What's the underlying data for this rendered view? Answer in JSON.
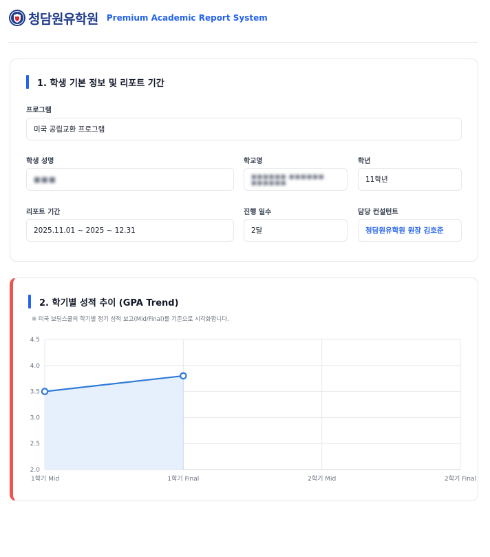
{
  "header": {
    "logo_text": "청담원유학원",
    "tagline": "Premium Academic Report System"
  },
  "section1": {
    "title": "1. 학생 기본 정보 및 리포트 기간",
    "program_label": "프로그램",
    "program_value": "미국 공립교환 프로그램",
    "student_name_label": "학생 성명",
    "student_name_value": "■■■",
    "school_label": "학교명",
    "school_value": "■■■■■■ ■■■■■■ ■■■■■■",
    "grade_label": "학년",
    "grade_value": "11학년",
    "period_label": "리포트 기간",
    "period_value": "2025.11.01 ~ 2025 ~ 12.31",
    "days_label": "진행 일수",
    "days_value": "2달",
    "consultant_label": "담당 컨설턴트",
    "consultant_value": "청담원유학원 원장 김호준"
  },
  "section2": {
    "title": "2. 학기별 성적 추이 (GPA Trend)",
    "note": "※ 미국 보딩스쿨의 학기별 정기 성적 보고(Mid/Final)를 기준으로 시각화합니다."
  },
  "colors": {
    "accent": "#2563eb",
    "card2_border": "#f05252",
    "line": "#2f7ad8",
    "fill": "#e6f0fd"
  },
  "chart_data": {
    "type": "line",
    "categories": [
      "1학기 Mid",
      "1학기 Final",
      "2학기 Mid",
      "2학기 Final"
    ],
    "series": [
      {
        "values": [
          3.5,
          3.8,
          null,
          null
        ]
      }
    ],
    "ylim": [
      2.0,
      4.5
    ],
    "yticks": [
      "2.0",
      "2.5",
      "3.0",
      "3.5",
      "4.0",
      "4.5"
    ],
    "grid": true,
    "fill_area": true
  }
}
